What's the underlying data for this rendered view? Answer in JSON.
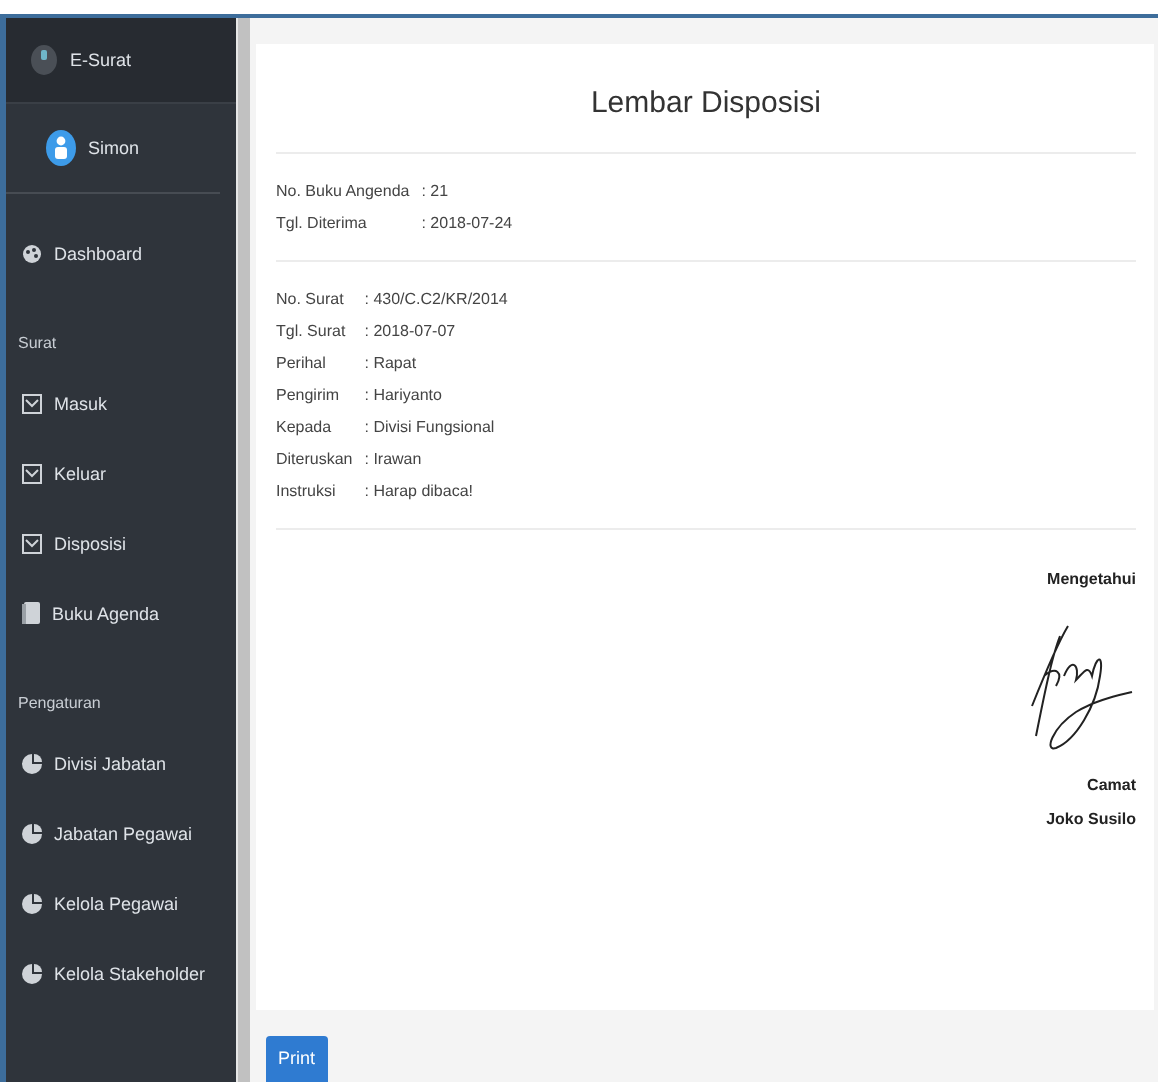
{
  "sidebar": {
    "brand": "E-Surat",
    "user": "Simon",
    "items": [
      {
        "kind": "dashboard",
        "label": "Dashboard"
      },
      {
        "kind": "section",
        "label": "Surat"
      },
      {
        "kind": "mail",
        "label": "Masuk"
      },
      {
        "kind": "mail",
        "label": "Keluar"
      },
      {
        "kind": "mail",
        "label": "Disposisi"
      },
      {
        "kind": "book",
        "label": "Buku Agenda"
      },
      {
        "kind": "section",
        "label": "Pengaturan"
      },
      {
        "kind": "chart",
        "label": "Divisi Jabatan"
      },
      {
        "kind": "chart",
        "label": "Jabatan Pegawai"
      },
      {
        "kind": "chart",
        "label": "Kelola Pegawai"
      },
      {
        "kind": "chart",
        "label": "Kelola Stakeholder"
      }
    ]
  },
  "document": {
    "title": "Lembar Disposisi",
    "groups": [
      [
        {
          "label": "No. Buku Angenda",
          "value": ": 21"
        },
        {
          "label": "Tgl. Diterima",
          "value": ": 2018-07-24"
        }
      ],
      [
        {
          "label": "No. Surat",
          "value": ": 430/C.C2/KR/2014"
        },
        {
          "label": "Tgl. Surat",
          "value": ": 2018-07-07"
        },
        {
          "label": "Perihal",
          "value": ": Rapat"
        },
        {
          "label": "Pengirim",
          "value": ": Hariyanto"
        },
        {
          "label": "Kepada",
          "value": ": Divisi Fungsional"
        },
        {
          "label": "Diteruskan",
          "value": ": Irawan"
        },
        {
          "label": "Instruksi",
          "value": ": Harap dibaca!"
        }
      ]
    ],
    "signature": {
      "heading": "Mengetahui",
      "position": "Camat",
      "name": "Joko Susilo"
    }
  },
  "footer": {
    "button": "Print"
  }
}
